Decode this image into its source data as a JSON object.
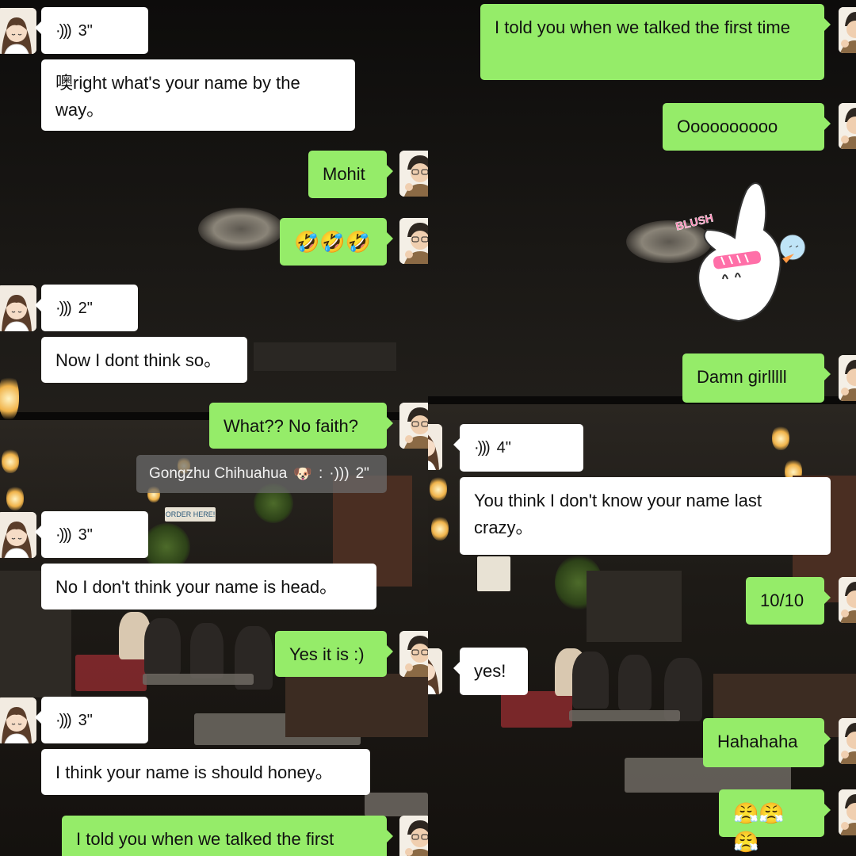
{
  "contact_name": "Gongzhu Chihuahua",
  "colors": {
    "sent_bubble": "#95ec69",
    "received_bubble": "#ffffff",
    "system_notice": "#6e6e6e"
  },
  "left": {
    "m1": {
      "icon": "voice-wave-icon",
      "duration": "3\""
    },
    "m2": {
      "text": "噢right what's your name by the way。"
    },
    "m3": {
      "text": "Mohit"
    },
    "m4": {
      "text": "🤣🤣🤣"
    },
    "m5": {
      "icon": "voice-wave-icon",
      "duration": "2\""
    },
    "m6": {
      "text": "Now I dont think so。"
    },
    "m7": {
      "text": "What?? No faith?"
    },
    "notice": {
      "name": "Gongzhu Chihuahua",
      "emoji": "🐶",
      "sep": ":",
      "duration": "2\""
    },
    "m8": {
      "icon": "voice-wave-icon",
      "duration": "3\""
    },
    "m9": {
      "text": "No I don't think your name is head。"
    },
    "m10": {
      "text": "Yes it is :)"
    },
    "m11": {
      "icon": "voice-wave-icon",
      "duration": "3\""
    },
    "m12": {
      "text": "I think your name is should honey。"
    },
    "m13": {
      "text": "I told you when we talked the first"
    }
  },
  "right": {
    "m1": {
      "text": "I told you when we talked the first time"
    },
    "m2": {
      "text": "Oooooooooo"
    },
    "sticker": {
      "text": "BLUSH"
    },
    "m3": {
      "text": "Damn girlllll"
    },
    "m4": {
      "icon": "voice-wave-icon",
      "duration": "4\""
    },
    "m5": {
      "text": "You think I don't know your name last crazy。"
    },
    "m6": {
      "text": "10/10"
    },
    "m7": {
      "text": "yes!"
    },
    "m8": {
      "text": "Hahahaha"
    },
    "m9": {
      "text": "😤😤😤"
    }
  },
  "background_signs": {
    "order_here": "ORDER HERE!"
  }
}
